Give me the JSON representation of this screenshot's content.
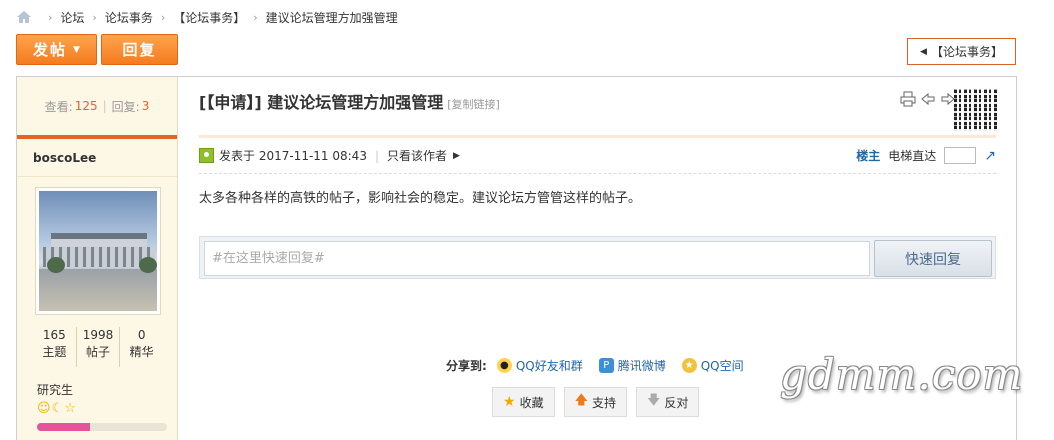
{
  "breadcrumb": {
    "items": [
      "论坛",
      "论坛事务",
      "【论坛事务】",
      "建议论坛管理方加强管理"
    ]
  },
  "toolbar": {
    "post_label": "发帖",
    "reply_label": "回复",
    "back_label": "【论坛事务】"
  },
  "thread": {
    "views_label": "查看:",
    "views": "125",
    "replies_label": "回复:",
    "replies": "3",
    "title": "[【申请】] 建议论坛管理方加强管理",
    "copy_link": "[复制链接]"
  },
  "author": {
    "name": "boscoLee",
    "stats": [
      {
        "value": "165",
        "label": "主题"
      },
      {
        "value": "1998",
        "label": "帖子"
      },
      {
        "value": "0",
        "label": "精华"
      }
    ],
    "rank": "研究生",
    "level_progress": 0.41,
    "colors": {
      "accent": "#e5632a",
      "progress": "#e5549a"
    }
  },
  "post": {
    "posted_at": "发表于 2017-11-11 08:43",
    "only_author": "只看该作者",
    "floor_label": "楼主",
    "jump_label": "电梯直达",
    "content": "太多各种各样的高铁的帖子，影响社会的稳定。建议论坛方管管这样的帖子。"
  },
  "quick_reply": {
    "placeholder": "#在这里快速回复#",
    "button": "快速回复"
  },
  "share": {
    "label": "分享到:",
    "targets": [
      {
        "label": "QQ好友和群",
        "icon": "qq-icon"
      },
      {
        "label": "腾讯微博",
        "icon": "tencent-weibo-icon"
      },
      {
        "label": "QQ空间",
        "icon": "qzone-icon"
      }
    ]
  },
  "actions": {
    "favorite": "收藏",
    "support": "支持",
    "oppose": "反对"
  },
  "watermark": "gdmm.com"
}
